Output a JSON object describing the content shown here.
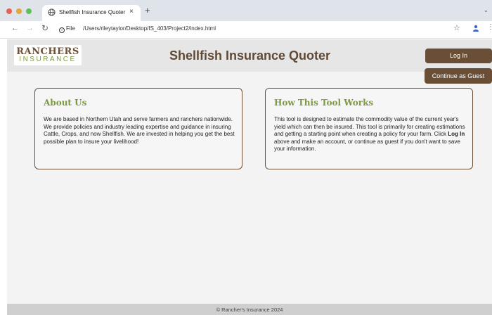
{
  "browser": {
    "tab_title": "Shellfish Insurance Quoter",
    "tab_close": "×",
    "new_tab": "+",
    "file_label": "File",
    "url": "/Users/rileytaylor/Desktop/IS_403/Project2/index.html"
  },
  "header": {
    "logo_top": "RANCHERS",
    "logo_bottom": "INSURANCE",
    "title": "Shellfish Insurance Quoter",
    "login_label": "Log In",
    "guest_label": "Continue as Guest"
  },
  "about": {
    "heading": "About Us",
    "body": "We are based in Northern Utah and serve farmers and ranchers nationwide. We provide policies and industry leading expertise and guidance in insuring Cattle, Crops, and now Shellfish. We are invested in helping you get the best possible plan to insure your livelihood!"
  },
  "how": {
    "heading": "How This Tool Works",
    "body_before": "This tool is designed to estimate the commodity value of the current year's yield which can then be insured. This tool is primarily for creating estimations and getting a starting point when creating a policy for your farm. Click ",
    "body_bold": "Log In",
    "body_after": " above and make an account, or continue as guest if you don't want to save your information."
  },
  "footer": {
    "text": "© Rancher's Insurance 2024"
  },
  "colors": {
    "brown": "#6a4f36",
    "green": "#7c9a41",
    "page_bg": "#f3f3f3"
  },
  "icons": [
    "globe-icon",
    "back-arrow-icon",
    "forward-arrow-icon",
    "reload-icon",
    "info-icon",
    "star-icon",
    "profile-icon",
    "kebab-menu-icon"
  ]
}
